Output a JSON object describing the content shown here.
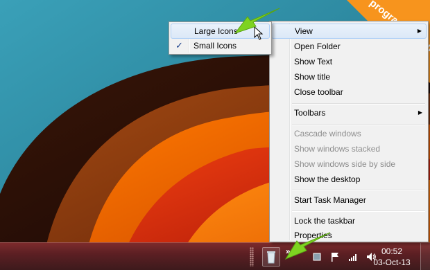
{
  "context_menu": {
    "items": [
      {
        "label": "View",
        "state": "highlighted",
        "submenu": true
      },
      {
        "label": "Open Folder",
        "state": "enabled"
      },
      {
        "label": "Show Text",
        "state": "enabled"
      },
      {
        "label": "Show title",
        "state": "enabled"
      },
      {
        "label": "Close toolbar",
        "state": "enabled"
      },
      {
        "label": "Toolbars",
        "state": "enabled",
        "submenu": true
      },
      {
        "label": "Cascade windows",
        "state": "disabled"
      },
      {
        "label": "Show windows stacked",
        "state": "disabled"
      },
      {
        "label": "Show windows side by side",
        "state": "disabled"
      },
      {
        "label": "Show the desktop",
        "state": "enabled"
      },
      {
        "label": "Start Task Manager",
        "state": "enabled"
      },
      {
        "label": "Lock the taskbar",
        "state": "enabled"
      },
      {
        "label": "Properties",
        "state": "enabled"
      }
    ]
  },
  "view_submenu": {
    "items": [
      {
        "label": "Large Icons",
        "state": "hover"
      },
      {
        "label": "Small Icons",
        "state": "checked"
      }
    ],
    "check_mark": "✓"
  },
  "taskbar": {
    "clock_time": "00:52",
    "clock_date": "03-Oct-13",
    "overflow_chevron": "»"
  },
  "watermark": {
    "text": "programecalculator.ro"
  },
  "colors": {
    "arrow": "#7ed321",
    "menu_bg": "#f1f1f1",
    "disabled_text": "#8d8d8d",
    "banner": "#f7941d"
  }
}
